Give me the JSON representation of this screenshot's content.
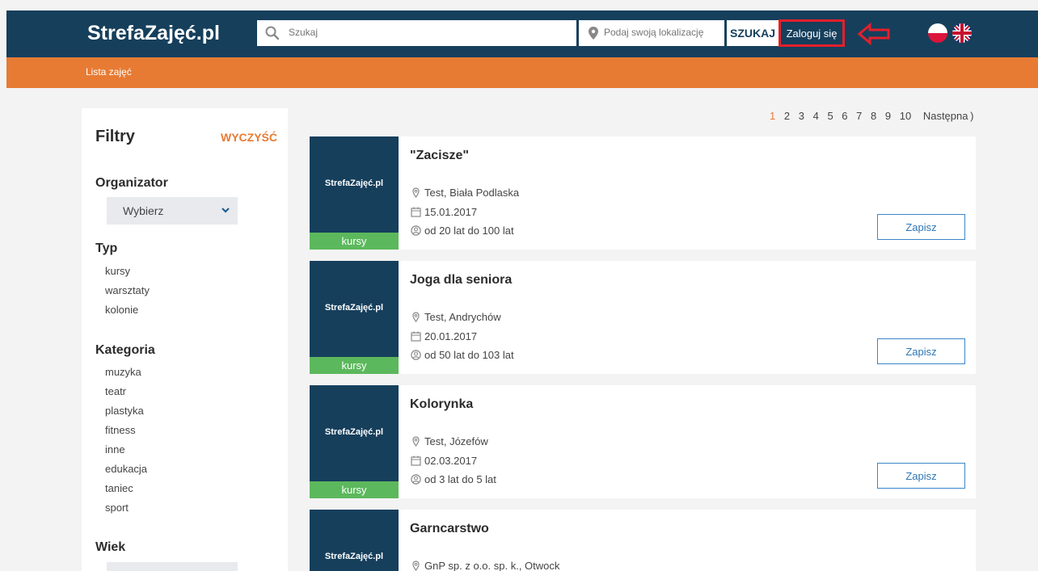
{
  "header": {
    "logo": "StrefaZajęć.pl",
    "search_placeholder": "Szukaj",
    "location_placeholder": "Podaj swoją lokalizację",
    "search_button": "SZUKAJ",
    "login_button": "Zaloguj się",
    "accent_color": "#e3202b"
  },
  "subnav": {
    "list_link": "Lista zajęć"
  },
  "filters": {
    "title": "Filtry",
    "clear": "WYCZYŚĆ",
    "organizer": {
      "label": "Organizator",
      "selected": "Wybierz"
    },
    "type": {
      "label": "Typ",
      "items": [
        "kursy",
        "warsztaty",
        "kolonie"
      ]
    },
    "category": {
      "label": "Kategoria",
      "items": [
        "muzyka",
        "teatr",
        "plastyka",
        "fitness",
        "inne",
        "edukacja",
        "taniec",
        "sport"
      ]
    },
    "age": {
      "label": "Wiek"
    }
  },
  "pagination": {
    "pages": [
      "1",
      "2",
      "3",
      "4",
      "5",
      "6",
      "7",
      "8",
      "9",
      "10"
    ],
    "active": "1",
    "next": "Następna"
  },
  "listings": [
    {
      "brand": "StrefaZajęć.pl",
      "tag": "kursy",
      "title": "\"Zacisze\"",
      "location": "Test, Biała Podlaska",
      "date": "15.01.2017",
      "age": "od 20 lat do 100 lat",
      "button": "Zapisz"
    },
    {
      "brand": "StrefaZajęć.pl",
      "tag": "kursy",
      "title": "Joga dla seniora",
      "location": "Test, Andrychów",
      "date": "20.01.2017",
      "age": "od 50 lat do 103 lat",
      "button": "Zapisz"
    },
    {
      "brand": "StrefaZajęć.pl",
      "tag": "kursy",
      "title": "Kolorynka",
      "location": "Test, Józefów",
      "date": "02.03.2017",
      "age": "od 3 lat do 5 lat",
      "button": "Zapisz"
    },
    {
      "brand": "StrefaZajęć.pl",
      "title": "Garncarstwo",
      "location": "GnP sp. z o.o. sp. k., Otwock"
    }
  ],
  "colors": {
    "navy": "#163f5c",
    "orange": "#e77b34",
    "green": "#5cb85c",
    "button_blue": "#2f77b5"
  }
}
